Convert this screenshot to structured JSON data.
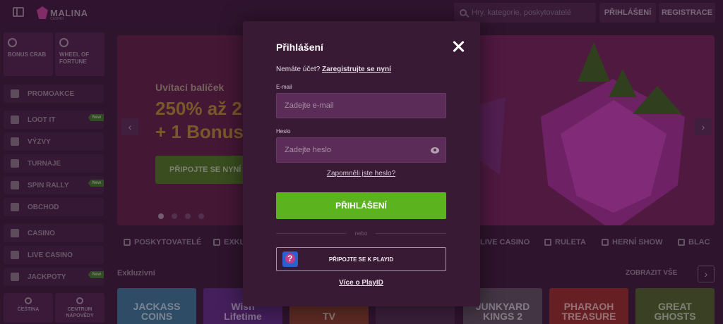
{
  "header": {
    "logo_text": "MALINA",
    "logo_sub": "CASINO",
    "search_placeholder": "Hry, kategorie, poskytovatelé",
    "login_label": "PŘIHLÁŠENÍ",
    "register_label": "REGISTRACE"
  },
  "sidebar": {
    "tiles": [
      {
        "label": "BONUS CRAB",
        "icon": "crab-icon"
      },
      {
        "label": "WHEEL OF FORTUNE",
        "icon": "wheel-icon"
      }
    ],
    "items": [
      {
        "label": "PROMOAKCE",
        "icon": "promo-icon",
        "badge": ""
      },
      {
        "label": "LOOT IT",
        "icon": "loot-icon",
        "badge": "New"
      },
      {
        "label": "VÝZVY",
        "icon": "challenge-icon",
        "badge": ""
      },
      {
        "label": "TURNAJE",
        "icon": "trophy-icon",
        "badge": ""
      },
      {
        "label": "SPIN RALLY",
        "icon": "rally-icon",
        "badge": "New"
      },
      {
        "label": "OBCHOD",
        "icon": "shop-icon",
        "badge": ""
      },
      {
        "label": "CASINO",
        "icon": "casino-icon",
        "badge": ""
      },
      {
        "label": "LIVE CASINO",
        "icon": "live-icon",
        "badge": ""
      },
      {
        "label": "JACKPOTY",
        "icon": "jackpot-icon",
        "badge": "New"
      }
    ],
    "bottom": [
      {
        "label": "ČEŠTINA",
        "icon": "flag-icon"
      },
      {
        "label": "CENTRUM NÁPOVĚDY",
        "icon": "help-icon"
      }
    ]
  },
  "hero": {
    "kicker": "Uvítací balíček",
    "title": "250% až 2\n+ 1 Bonus",
    "cta": "PŘIPOJTE SE NYNÍ",
    "slides": 4,
    "active_slide": 1
  },
  "categories": [
    "POSKYTOVATELÉ",
    "EXKL",
    "LIVE CASINO",
    "RULETA",
    "HERNÍ SHOW",
    "BLAC"
  ],
  "section": {
    "title": "Exkluzivní",
    "see_all": "ZOBRAZIT VŠE"
  },
  "games": [
    "JACKASS\nCOINS",
    "Wish\nLifetime",
    "TV",
    "",
    "JUNKYARD\nKINGS 2",
    "PHARAOH\nTREASURE",
    "GREAT\nGHOSTS"
  ],
  "modal": {
    "title": "Přihlášení",
    "no_account": "Nemáte účet?",
    "register_link": "Zaregistrujte se nyní",
    "email_label": "E-mail",
    "email_placeholder": "Zadejte e-mail",
    "password_label": "Heslo",
    "password_placeholder": "Zadejte heslo",
    "forgot": "Zapomněli jste heslo?",
    "login_button": "PŘIHLÁŠENÍ",
    "divider": "nebo",
    "playid_button": "PŘIPOJTE SE K PLAYID",
    "about_playid": "Více o PlayID"
  },
  "colors": {
    "accent_green": "#5bb31e",
    "modal_bg": "#381a35",
    "field_bg": "#5b2c58"
  }
}
